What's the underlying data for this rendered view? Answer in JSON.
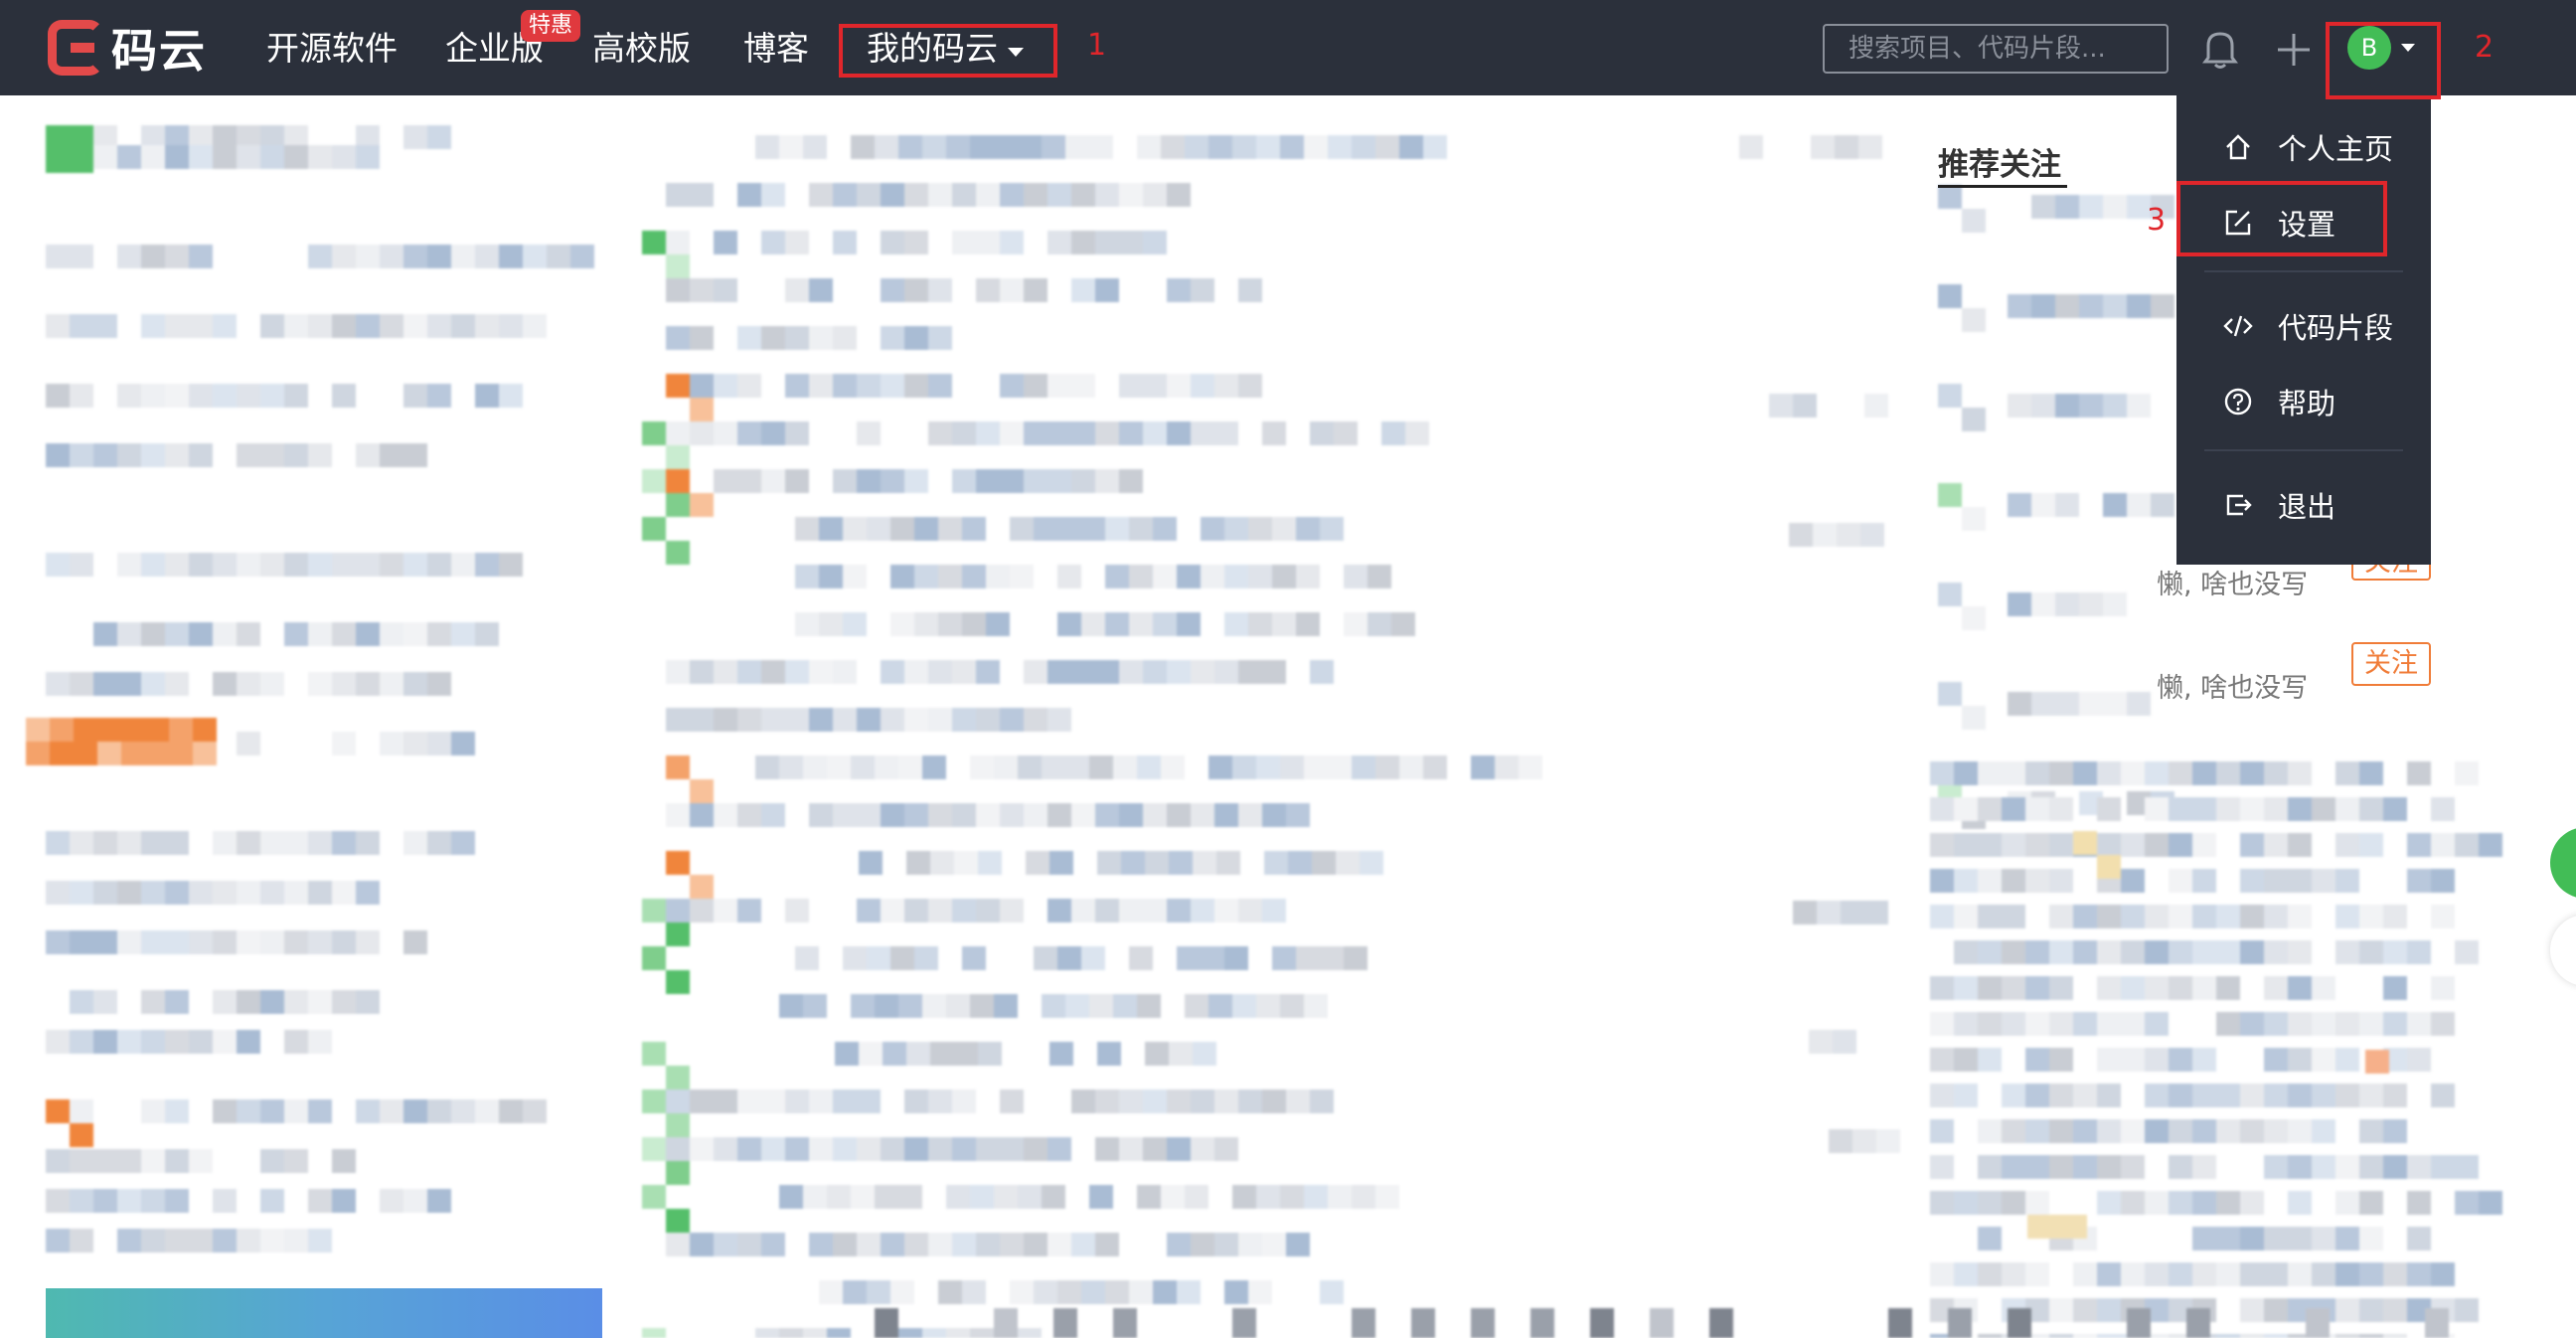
{
  "logo": {
    "text": "码云"
  },
  "nav": {
    "items": [
      "开源软件",
      "企业版",
      "高校版",
      "博客"
    ],
    "badge": "特惠",
    "mine_label": "我的码云"
  },
  "search": {
    "placeholder": "搜索项目、代码片段..."
  },
  "user": {
    "avatar_letter": "B"
  },
  "annotations": [
    "1",
    "2",
    "3"
  ],
  "dropdown": {
    "items": [
      {
        "label": "个人主页",
        "icon": "home-icon"
      },
      {
        "label": "设置",
        "icon": "edit-icon"
      },
      {
        "label": "代码片段",
        "icon": "code-icon"
      },
      {
        "label": "帮助",
        "icon": "help-icon"
      },
      {
        "label": "退出",
        "icon": "logout-icon"
      }
    ]
  },
  "recommend": {
    "title": "推荐关注",
    "desc_partial": "懒, 啥也没写",
    "follow_label": "关注"
  },
  "colors": {
    "navbar_bg": "#2b303b",
    "annotation_red": "#e0262b",
    "avatar_green": "#42bd56",
    "follow_orange": "#f07c38"
  }
}
